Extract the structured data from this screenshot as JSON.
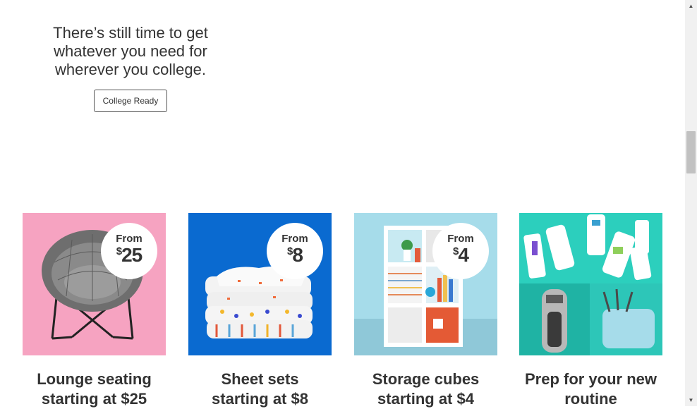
{
  "hero": {
    "text": "There’s still time to get\nwhatever you need for\nwherever you college.",
    "button_label": "College Ready"
  },
  "tiles": [
    {
      "badge_from": "From",
      "badge_currency": "$",
      "badge_amount": "25",
      "caption": "Lounge seating\nstarting at $25",
      "bg_color": "#f6a3c1"
    },
    {
      "badge_from": "From",
      "badge_currency": "$",
      "badge_amount": "8",
      "caption": "Sheet sets\nstarting at $8",
      "bg_color": "#0a6ad0"
    },
    {
      "badge_from": "From",
      "badge_currency": "$",
      "badge_amount": "4",
      "caption": "Storage cubes\nstarting at $4",
      "bg_color": "#a6dcea"
    },
    {
      "caption": "Prep for your new\nroutine",
      "bg_color": "#22c3b4"
    }
  ]
}
